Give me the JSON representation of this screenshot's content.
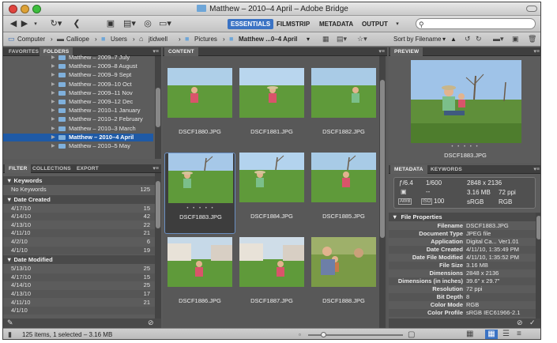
{
  "window": {
    "title": "Matthew – 2010–4 April – Adobe Bridge"
  },
  "workspaces": [
    {
      "label": "ESSENTIALS",
      "active": true
    },
    {
      "label": "FILMSTRIP",
      "active": false
    },
    {
      "label": "METADATA",
      "active": false
    },
    {
      "label": "OUTPUT",
      "active": false
    }
  ],
  "search": {
    "placeholder": ""
  },
  "path": [
    {
      "label": "Computer",
      "icon": "computer-icon"
    },
    {
      "label": "Calliope",
      "icon": "drive-icon"
    },
    {
      "label": "Users",
      "icon": "folder-icon"
    },
    {
      "label": "jtidwell",
      "icon": "home-icon"
    },
    {
      "label": "Pictures",
      "icon": "folder-icon"
    },
    {
      "label": "Matthew ...0–4 April",
      "icon": "folder-icon"
    }
  ],
  "sort": {
    "label": "Sort by Filename"
  },
  "left_panel": {
    "tabs": [
      "FAVORITES",
      "FOLDERS"
    ],
    "active_tab": "FOLDERS",
    "folders": [
      {
        "label": "Matthew – 2009–7 July",
        "selected": false
      },
      {
        "label": "Matthew – 2009–8 August",
        "selected": false
      },
      {
        "label": "Matthew – 2009–9 Sept",
        "selected": false
      },
      {
        "label": "Matthew – 2009–10 Oct",
        "selected": false
      },
      {
        "label": "Matthew – 2009–11 Nov",
        "selected": false
      },
      {
        "label": "Matthew – 2009–12 Dec",
        "selected": false
      },
      {
        "label": "Matthew – 2010–1 January",
        "selected": false
      },
      {
        "label": "Matthew – 2010–2 February",
        "selected": false
      },
      {
        "label": "Matthew – 2010–3 March",
        "selected": false
      },
      {
        "label": "Matthew – 2010–4 April",
        "selected": true
      },
      {
        "label": "Matthew – 2010–5 May",
        "selected": false
      }
    ]
  },
  "filter_panel": {
    "tabs": [
      "FILTER",
      "COLLECTIONS",
      "EXPORT"
    ],
    "active_tab": "FILTER",
    "keywords": {
      "title": "Keywords",
      "rows": [
        {
          "k": "No Keywords",
          "v": "125"
        }
      ]
    },
    "date_created": {
      "title": "Date Created",
      "rows": [
        {
          "k": "4/17/10",
          "v": "15"
        },
        {
          "k": "4/14/10",
          "v": "42"
        },
        {
          "k": "4/13/10",
          "v": "22"
        },
        {
          "k": "4/11/10",
          "v": "21"
        },
        {
          "k": "4/2/10",
          "v": "6"
        },
        {
          "k": "4/1/10",
          "v": "19"
        }
      ]
    },
    "date_modified": {
      "title": "Date Modified",
      "rows": [
        {
          "k": "5/13/10",
          "v": "25"
        },
        {
          "k": "4/17/10",
          "v": "15"
        },
        {
          "k": "4/14/10",
          "v": "25"
        },
        {
          "k": "4/13/10",
          "v": "17"
        },
        {
          "k": "4/11/10",
          "v": "21"
        },
        {
          "k": "4/1/10",
          "v": ""
        }
      ]
    }
  },
  "content": {
    "tab": "CONTENT",
    "thumbnails": [
      {
        "name": "DSCF1880.JPG",
        "selected": false
      },
      {
        "name": "DSCF1881.JPG",
        "selected": false
      },
      {
        "name": "DSCF1882.JPG",
        "selected": false
      },
      {
        "name": "DSCF1883.JPG",
        "selected": true
      },
      {
        "name": "DSCF1884.JPG",
        "selected": false
      },
      {
        "name": "DSCF1885.JPG",
        "selected": false
      },
      {
        "name": "DSCF1886.JPG",
        "selected": false
      },
      {
        "name": "DSCF1887.JPG",
        "selected": false
      },
      {
        "name": "DSCF1888.JPG",
        "selected": false
      }
    ]
  },
  "preview": {
    "tab": "PREVIEW",
    "caption": "DSCF1883.JPG",
    "dots": "• • • • •"
  },
  "metadata": {
    "tabs": [
      "METADATA",
      "KEYWORDS"
    ],
    "active_tab": "METADATA",
    "summary": {
      "aperture": "ƒ/6.4",
      "shutter": "1/600",
      "flash": "--",
      "iso": "100",
      "dims": "2848 x 2136",
      "size": "3.16 MB",
      "ppi": "72 ppi",
      "profile": "sRGB",
      "mode": "RGB",
      "wb": "AWB",
      "iso_label": "ISO"
    },
    "section_title": "File Properties",
    "rows": [
      {
        "k": "Filename",
        "v": "DSCF1883.JPG"
      },
      {
        "k": "Document Type",
        "v": "JPEG file"
      },
      {
        "k": "Application",
        "v": "Digital Ca...  Ver1.01"
      },
      {
        "k": "Date Created",
        "v": "4/11/10, 1:35:49 PM"
      },
      {
        "k": "Date File Modified",
        "v": "4/11/10, 1:35:52 PM"
      },
      {
        "k": "File Size",
        "v": "3.16 MB"
      },
      {
        "k": "Dimensions",
        "v": "2848 x 2136"
      },
      {
        "k": "Dimensions (in inches)",
        "v": "39.6\" x 29.7\""
      },
      {
        "k": "Resolution",
        "v": "72 ppi"
      },
      {
        "k": "Bit Depth",
        "v": "8"
      },
      {
        "k": "Color Mode",
        "v": "RGB"
      },
      {
        "k": "Color Profile",
        "v": "sRGB IEC61966-2.1"
      }
    ]
  },
  "status": {
    "text": "125 items, 1 selected – 3.16 MB"
  },
  "colors": {
    "selection": "#1f5aa6",
    "accent": "#3b73c4",
    "panel": "#5c5c5c"
  }
}
